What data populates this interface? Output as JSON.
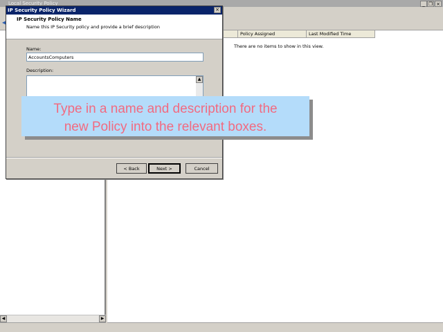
{
  "main_window": {
    "title": "Local Security Policy",
    "controls": {
      "minimize": "_",
      "restore": "❐",
      "close": "×"
    },
    "columns": [
      {
        "label": ""
      },
      {
        "label": "Policy Assigned"
      },
      {
        "label": "Last Modified Time"
      }
    ],
    "empty_message": "There are no items to show in this view."
  },
  "wizard": {
    "title": "IP Security Policy Wizard",
    "close_glyph": "×",
    "header_title": "IP Security Policy Name",
    "header_subtitle": "Name this IP Security policy and provide a brief description",
    "name_label": "Name:",
    "name_value": "AccountsComputers",
    "description_label": "Description:",
    "description_value": "",
    "buttons": {
      "back": "< Back",
      "next": "Next >",
      "cancel": "Cancel"
    }
  },
  "callout": {
    "line1": "Type in a name and description for the",
    "line2": "new Policy into the relevant boxes."
  },
  "icons": {
    "back": "back-arrow-icon"
  },
  "colors": {
    "wizard_title_bar": "#0a246a",
    "callout_bg": "#b4dcfa",
    "callout_text": "#f26a80"
  }
}
